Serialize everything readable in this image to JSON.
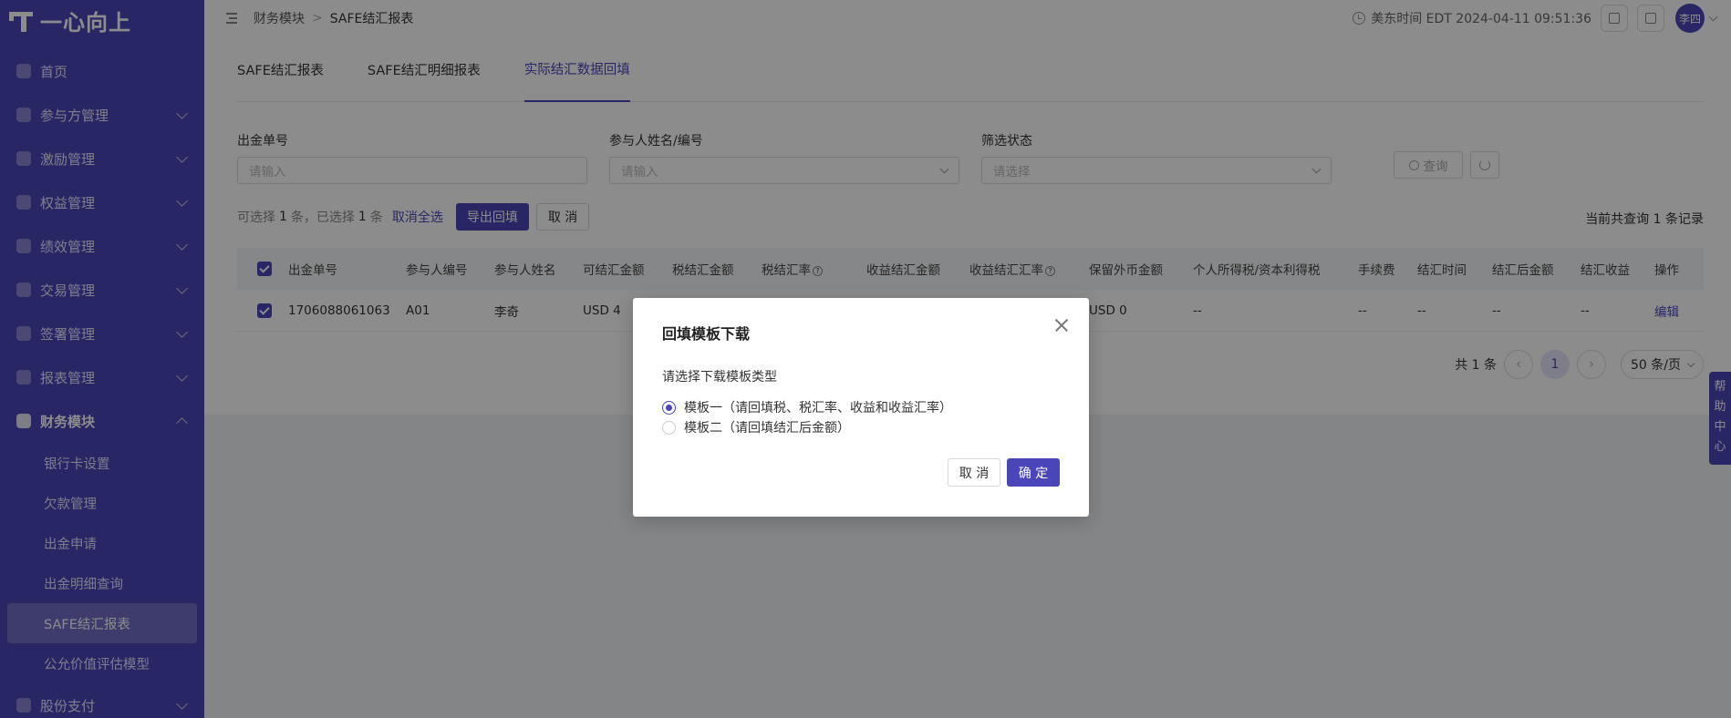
{
  "app": {
    "logo_text": "一心向上"
  },
  "sidebar": {
    "items": [
      {
        "label": "首页"
      },
      {
        "label": "参与方管理"
      },
      {
        "label": "激励管理"
      },
      {
        "label": "权益管理"
      },
      {
        "label": "绩效管理"
      },
      {
        "label": "交易管理"
      },
      {
        "label": "签署管理"
      },
      {
        "label": "报表管理"
      },
      {
        "label": "财务模块"
      },
      {
        "label": "股份支付"
      }
    ],
    "finance_sub": [
      {
        "label": "银行卡设置"
      },
      {
        "label": "欠款管理"
      },
      {
        "label": "出金申请"
      },
      {
        "label": "出金明细查询"
      },
      {
        "label": "SAFE结汇报表"
      },
      {
        "label": "公允价值评估模型"
      }
    ]
  },
  "header": {
    "breadcrumb": [
      "财务模块",
      "SAFE结汇报表"
    ],
    "separator": ">",
    "timezone_label": "美东时间 EDT 2024-04-11 09:51:36",
    "user_name": "李四"
  },
  "tabs": [
    {
      "label": "SAFE结汇报表"
    },
    {
      "label": "SAFE结汇明细报表"
    },
    {
      "label": "实际结汇数据回填"
    }
  ],
  "filters": {
    "order_no": {
      "label": "出金单号",
      "placeholder": "请输入"
    },
    "participant": {
      "label": "参与人姓名/编号",
      "placeholder": "请输入"
    },
    "status": {
      "label": "筛选状态",
      "placeholder": "请选择"
    },
    "search_label": "查询"
  },
  "actionbar": {
    "selectable_prefix": "可选择",
    "selectable_count": "1",
    "selectable_unit": "条，已选择",
    "selected_count": "1",
    "selected_unit": "条",
    "deselect_all": "取消全选",
    "export_label": "导出回填",
    "cancel_label": "取 消",
    "record_count": "当前共查询 1 条记录"
  },
  "table": {
    "headers": [
      "出金单号",
      "参与人编号",
      "参与人姓名",
      "可结汇金额",
      "税结汇金额",
      "税结汇率",
      "收益结汇金额",
      "收益结汇汇率",
      "保留外币金额",
      "个人所得税/资本利得税",
      "手续费",
      "结汇时间",
      "结汇后金额",
      "结汇收益",
      "操作"
    ],
    "rows": [
      [
        "1706088061063",
        "A01",
        "李奇",
        "USD 4",
        "",
        "",
        "",
        "",
        "USD 0",
        "--",
        "--",
        "--",
        "--",
        "--",
        "编辑"
      ]
    ]
  },
  "pager": {
    "total_label": "共 1 条",
    "current_page": "1",
    "page_size": "50 条/页"
  },
  "help": {
    "label": "帮助中心"
  },
  "modal": {
    "title": "回填模板下载",
    "prompt": "请选择下载模板类型",
    "options": [
      {
        "label": "模板一（请回填税、税汇率、收益和收益汇率）",
        "selected": true
      },
      {
        "label": "模板二（请回填结汇后金额）",
        "selected": false
      }
    ],
    "cancel_label": "取 消",
    "ok_label": "确 定"
  },
  "colors": {
    "primary": "#4a45b8"
  }
}
